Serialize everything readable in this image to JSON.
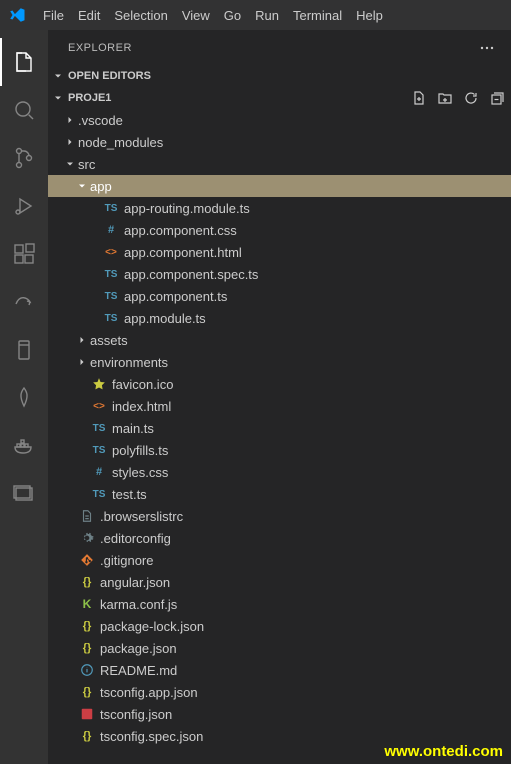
{
  "menubar": {
    "items": [
      "File",
      "Edit",
      "Selection",
      "View",
      "Go",
      "Run",
      "Terminal",
      "Help"
    ]
  },
  "sidebar": {
    "title": "EXPLORER",
    "openEditorsLabel": "OPEN EDITORS",
    "projectName": "PROJE1"
  },
  "tree": [
    {
      "depth": 0,
      "type": "folder",
      "expanded": false,
      "label": ".vscode"
    },
    {
      "depth": 0,
      "type": "folder",
      "expanded": false,
      "label": "node_modules"
    },
    {
      "depth": 0,
      "type": "folder",
      "expanded": true,
      "label": "src"
    },
    {
      "depth": 1,
      "type": "folder",
      "expanded": true,
      "label": "app",
      "selected": true
    },
    {
      "depth": 2,
      "type": "file",
      "icon": "ts",
      "label": "app-routing.module.ts"
    },
    {
      "depth": 2,
      "type": "file",
      "icon": "hash",
      "label": "app.component.css"
    },
    {
      "depth": 2,
      "type": "file",
      "icon": "html",
      "label": "app.component.html"
    },
    {
      "depth": 2,
      "type": "file",
      "icon": "ts",
      "label": "app.component.spec.ts"
    },
    {
      "depth": 2,
      "type": "file",
      "icon": "ts",
      "label": "app.component.ts"
    },
    {
      "depth": 2,
      "type": "file",
      "icon": "ts",
      "label": "app.module.ts"
    },
    {
      "depth": 1,
      "type": "folder",
      "expanded": false,
      "label": "assets"
    },
    {
      "depth": 1,
      "type": "folder",
      "expanded": false,
      "label": "environments"
    },
    {
      "depth": 1,
      "type": "file",
      "icon": "star",
      "label": "favicon.ico"
    },
    {
      "depth": 1,
      "type": "file",
      "icon": "html",
      "label": "index.html"
    },
    {
      "depth": 1,
      "type": "file",
      "icon": "ts",
      "label": "main.ts"
    },
    {
      "depth": 1,
      "type": "file",
      "icon": "ts",
      "label": "polyfills.ts"
    },
    {
      "depth": 1,
      "type": "file",
      "icon": "hash",
      "label": "styles.css"
    },
    {
      "depth": 1,
      "type": "file",
      "icon": "ts",
      "label": "test.ts"
    },
    {
      "depth": 0,
      "type": "file",
      "icon": "doc",
      "label": ".browserslistrc"
    },
    {
      "depth": 0,
      "type": "file",
      "icon": "gear",
      "label": ".editorconfig"
    },
    {
      "depth": 0,
      "type": "file",
      "icon": "git",
      "label": ".gitignore"
    },
    {
      "depth": 0,
      "type": "file",
      "icon": "json",
      "label": "angular.json"
    },
    {
      "depth": 0,
      "type": "file",
      "icon": "karma",
      "label": "karma.conf.js"
    },
    {
      "depth": 0,
      "type": "file",
      "icon": "json",
      "label": "package-lock.json"
    },
    {
      "depth": 0,
      "type": "file",
      "icon": "json",
      "label": "package.json"
    },
    {
      "depth": 0,
      "type": "file",
      "icon": "info",
      "label": "README.md"
    },
    {
      "depth": 0,
      "type": "file",
      "icon": "json",
      "label": "tsconfig.app.json"
    },
    {
      "depth": 0,
      "type": "file",
      "icon": "tsj",
      "label": "tsconfig.json"
    },
    {
      "depth": 0,
      "type": "file",
      "icon": "json",
      "label": "tsconfig.spec.json"
    }
  ],
  "watermark": "www.ontedi.com",
  "iconColors": {
    "ts": "#519aba",
    "hash": "#519aba",
    "html": "#e37933",
    "star": "#cbcb41",
    "doc": "#6d8086",
    "gear": "#6d8086",
    "git": "#e37933",
    "json": "#cbcb41",
    "karma": "#8dc149",
    "info": "#519aba",
    "tsj": "#cc3e44"
  }
}
